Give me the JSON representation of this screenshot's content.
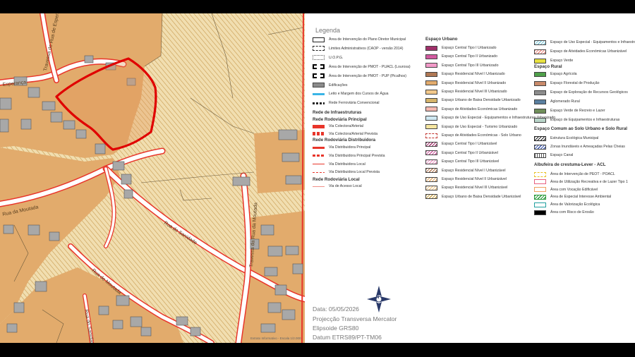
{
  "map": {
    "street_labels": [
      {
        "text": "Travessa do Rua de Esperança"
      },
      {
        "text": "Esperança"
      },
      {
        "text": "Rua da Moutada"
      },
      {
        "text": "Rua do Sanidade"
      },
      {
        "text": "Travessa da Rua da Moutada"
      },
      {
        "text": "Rua de Moutada"
      },
      {
        "text": "Rua do Sanidade"
      }
    ],
    "footer_text": "Extrato Informativo - Escala 1/2.000",
    "colors": {
      "urban_fill": "#e2ab6c",
      "hatch_fill": "#f1deb0",
      "building": "#a8a8a8",
      "road_edge": "#e8352a",
      "boundary": "#e00000"
    }
  },
  "legend": {
    "title": "Legenda",
    "col1": [
      {
        "label": "Área de Intervenção do Plano Diretor Municipal",
        "swatch": "box"
      },
      {
        "label": "Limites Administrativos (CAOP - versão 2014)",
        "swatch": "dashbox"
      },
      {
        "label": "U.O.P.G.",
        "swatch": "dotbox"
      },
      {
        "label": "Área de Intervenção de PMOT - PUACL (Lourosa)",
        "swatch": "blk"
      },
      {
        "label": "Área de Intervenção de PMOT - PUP (Picalhos)",
        "swatch": "blk"
      },
      {
        "label": "Edificações",
        "swatch": "grey"
      },
      {
        "label": "Leito e Margem dos Cursos de Água",
        "swatch": "cyan"
      },
      {
        "label": "Rede Ferroviária Convencional",
        "swatch": "rail"
      }
    ],
    "infra_head": "Rede de Infraestruturas",
    "principal_head": "Rede Rodoviária Principal",
    "principal": [
      {
        "label": "Via Colectora/Arterial",
        "swatch": "redthick"
      },
      {
        "label": "Via Colectora/Arterial Prevista",
        "swatch": "reddash"
      }
    ],
    "distrib_head": "Rede Rodoviária Distribuidora",
    "distrib": [
      {
        "label": "Via Distribuidora Principal",
        "swatch": "redmid"
      },
      {
        "label": "Via Distribuidora Principal Prevista",
        "swatch": "reddashmid"
      },
      {
        "label": "Via Distribuidora Local",
        "swatch": "redthin"
      },
      {
        "label": "Via Distribuidora Local Prevista",
        "swatch": "reddashthin"
      }
    ],
    "local_head": "Rede Rodoviária Local",
    "local": [
      {
        "label": "Via de Acesso Local",
        "swatch": "redhair"
      }
    ],
    "col2_head": "Espaço Urbano",
    "col2": [
      {
        "label": "Espaço Central Tipo I Urbanizado",
        "color": "#a0306a"
      },
      {
        "label": "Espaço Central Tipo II Urbanizado",
        "color": "#d25aa0"
      },
      {
        "label": "Espaço Central Tipo III Urbanizado",
        "color": "#f29ac8"
      },
      {
        "label": "Espaço Residencial Nível I Urbanizado",
        "color": "#b07854"
      },
      {
        "label": "Espaço Residencial Nível II Urbanizado",
        "color": "#e2ab6c"
      },
      {
        "label": "Espaço Residencial Nível III Urbanizado",
        "color": "#f2c88a"
      },
      {
        "label": "Espaço Urbano de Baixa Densidade Urbanizado",
        "color": "#d6b46a"
      },
      {
        "label": "Espaço de Atividades Económicas Urbanizado",
        "color": "#f5b8b0"
      },
      {
        "label": "Espaço de Uso Especial - Equipamentos e Infraestruturas Urbanizado",
        "color": "#cfe8f2"
      },
      {
        "label": "Espaço de Uso Especial - Turismo Urbanizado",
        "color": "#f6e6a0"
      },
      {
        "label": "Espaço de Atividades Económicas - Solo Urbano",
        "color": "dashred"
      },
      {
        "label": "Espaço Central Tipo I Urbanizável",
        "color": "hatch:#a0306a"
      },
      {
        "label": "Espaço Central Tipo II Urbanizável",
        "color": "hatch:#d25aa0"
      },
      {
        "label": "Espaço Central Tipo III Urbanizável",
        "color": "hatch:#f29ac8"
      },
      {
        "label": "Espaço Residencial Nível I Urbanizável",
        "color": "hatch:#b07854"
      },
      {
        "label": "Espaço Residencial Nível II Urbanizável",
        "color": "hatch:#e2ab6c"
      },
      {
        "label": "Espaço Residencial Nível III Urbanizável",
        "color": "hatch:#f2c88a"
      },
      {
        "label": "Espaço Urbano de Baixa Densidade Urbanizável",
        "color": "hatch:#c8a34a"
      }
    ],
    "col3": [
      {
        "label": "Espaço de Uso Especial - Equipamentos e Infraestruturas Urbanizável",
        "color": "hatch:#7cc6d8"
      },
      {
        "label": "Espaço de Atividades Económicas Urbanizável",
        "color": "hatch:#f08a80"
      },
      {
        "label": "Espaço Verde",
        "color": "#e6e040"
      }
    ],
    "rural_head": "Espaço Rural",
    "rural": [
      {
        "label": "Espaço Agrícola",
        "color": "#4fa04a"
      },
      {
        "label": "Espaço Florestal de Produção",
        "color": "#c98a6a"
      },
      {
        "label": "Espaço de Exploração de Recursos Geológicos",
        "color": "#8c8c8c"
      },
      {
        "label": "Aglomerado Rural",
        "color": "#5a7fa0"
      },
      {
        "label": "Espaço Verde de Recreio e Lazer",
        "color": "#6f8f5a"
      },
      {
        "label": "Espaço de Equipamentos e Infraestruturas",
        "color": "#b8d4c8"
      }
    ],
    "comum_head": "Espaço Comum ao Solo Urbano e Solo Rural",
    "comum": [
      {
        "label": "Estrutura Ecológica Municipal",
        "color": "hatchbox"
      },
      {
        "label": "Zonas Inundáveis e Ameaçadas Pelas Cheias",
        "color": "hatch:#3a56b0"
      },
      {
        "label": "Espaço Canal",
        "color": "grid"
      }
    ],
    "acl_head": "Albufeira de crestuma-Lever - ACL",
    "acl": [
      {
        "label": "Área de Intervenção de PEOT - POACL",
        "color": "dashyellow"
      },
      {
        "label": "Área de Utilização Recreativa e de Lazer Tipo 1",
        "color": "pinkbox"
      },
      {
        "label": "Área com Vocação Edificável",
        "color": "peachbox"
      },
      {
        "label": "Área de Especial Interesse Ambiental",
        "color": "greenhatch"
      },
      {
        "label": "Área de Valorização Ecológica",
        "color": "tealbox"
      },
      {
        "label": "Área com Risco de Erosão",
        "color": "#000000"
      }
    ]
  },
  "info": {
    "date": "Data:  05/05/2026",
    "projection": "Projecção Transversa Mercator",
    "ellipsoid": "Elipsoide GRS80",
    "datum": "Datum ETRS89/PT-TM06",
    "north_label": "N"
  }
}
